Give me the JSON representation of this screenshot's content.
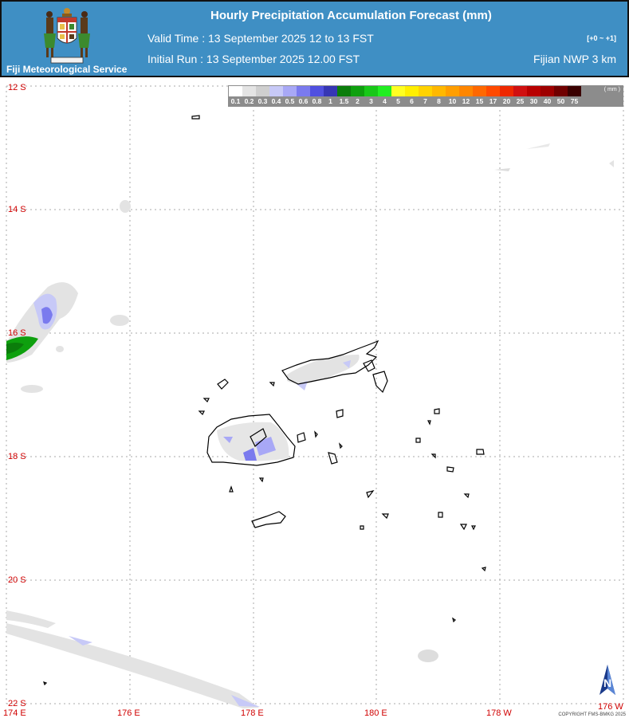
{
  "header": {
    "title": "Hourly Precipitation Accumulation Forecast (mm)",
    "valid_time": "Valid Time : 13 September 2025 12 to 13 FST",
    "initial_run": "Initial Run  : 13 September 2025 12.00 FST",
    "range": "[+0 ~ +1]",
    "model": "Fijian NWP 3 km",
    "org": "Fiji Meteorological Service",
    "crest_icon": "fiji-coat-of-arms"
  },
  "legend": {
    "unit": "( mm )",
    "labels": [
      "0.1",
      "0.2",
      "0.3",
      "0.4",
      "0.5",
      "0.6",
      "0.8",
      "1",
      "1.5",
      "2",
      "3",
      "4",
      "5",
      "6",
      "7",
      "8",
      "10",
      "12",
      "15",
      "17",
      "20",
      "25",
      "30",
      "40",
      "50",
      "75"
    ],
    "colors": [
      "#ffffff",
      "#e4e4e4",
      "#cfcfcf",
      "#c7c9f7",
      "#a8a8f6",
      "#7a7aee",
      "#5050e0",
      "#3636b4",
      "#0b7d0b",
      "#0ea00e",
      "#18c818",
      "#22ee22",
      "#ffff22",
      "#ffee00",
      "#ffd200",
      "#ffb800",
      "#ff9e00",
      "#ff8600",
      "#ff6800",
      "#ff4a00",
      "#ee2800",
      "#d01010",
      "#b80000",
      "#9e0000",
      "#700000",
      "#3a0000"
    ]
  },
  "lat_labels": [
    "12 S",
    "14 S",
    "16 S",
    "18 S",
    "20 S",
    "22 S"
  ],
  "lon_labels": [
    "174 E",
    "176 E",
    "178 E",
    "180 E",
    "178 W",
    "176 W"
  ],
  "compass": "N",
  "copyright": "COPYRIGHT FMS-BMKG 2025"
}
